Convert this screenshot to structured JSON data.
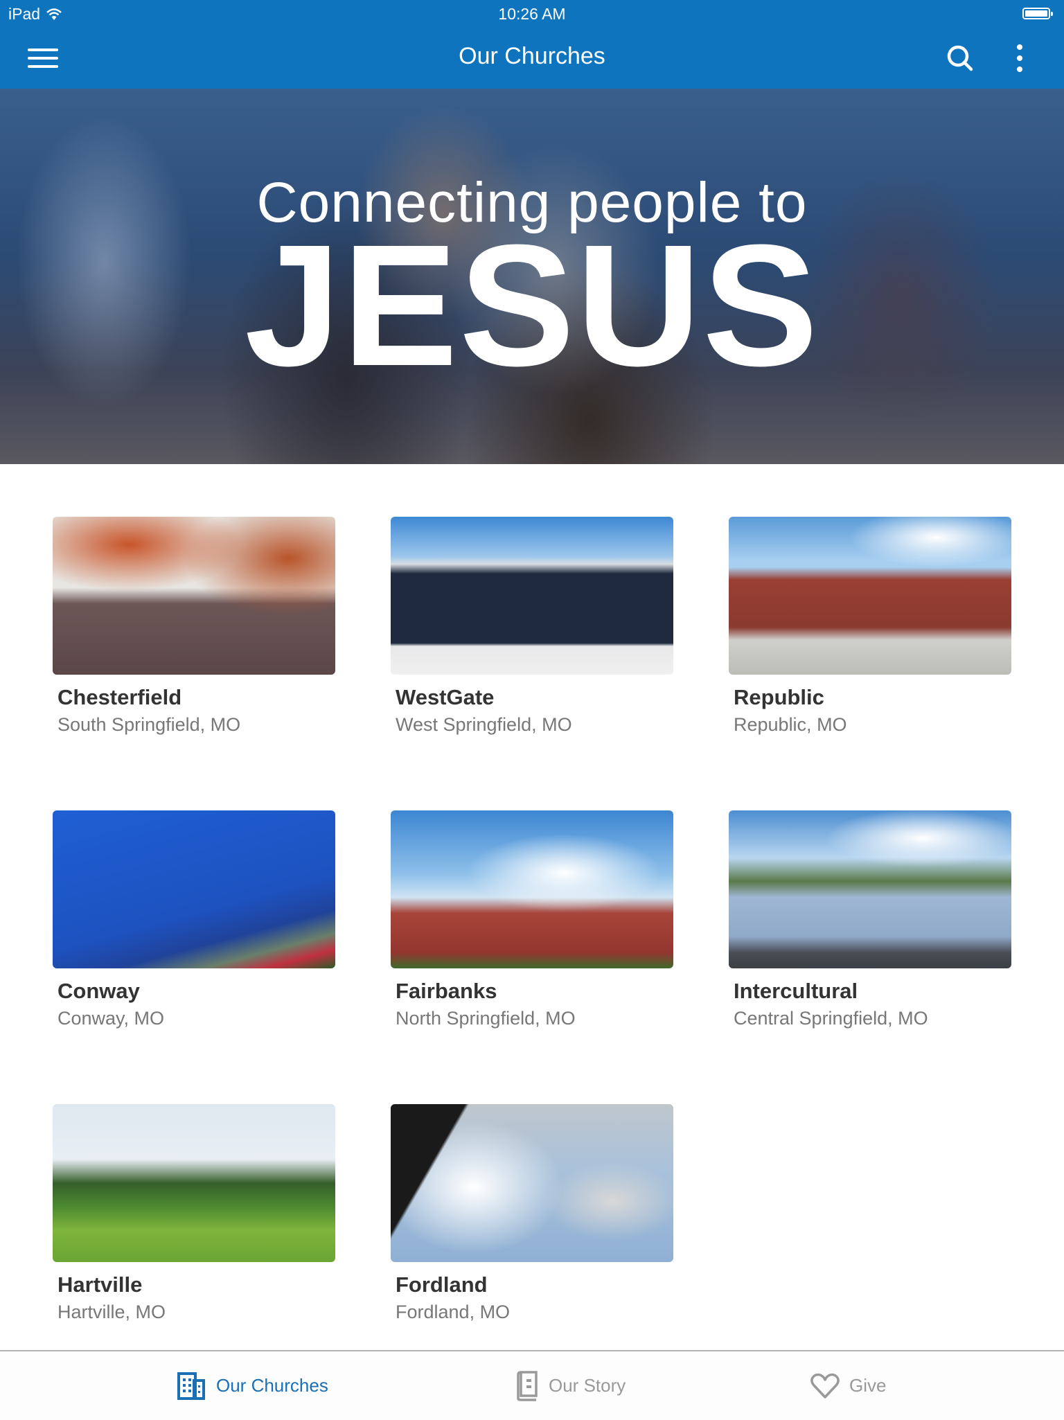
{
  "status_bar": {
    "device": "iPad",
    "time": "10:26 AM",
    "wifi_icon": "wifi-icon",
    "battery_icon": "battery-full-icon"
  },
  "nav_bar": {
    "title": "Our Churches",
    "menu_icon": "hamburger-menu-icon",
    "search_icon": "search-icon",
    "more_icon": "more-vertical-icon",
    "background_color": "#0e74bd"
  },
  "hero": {
    "line1": "Connecting people to",
    "line2": "JESUS"
  },
  "churches": [
    {
      "name": "Chesterfield",
      "location": "South Springfield, MO"
    },
    {
      "name": "WestGate",
      "location": "West Springfield, MO"
    },
    {
      "name": "Republic",
      "location": "Republic, MO"
    },
    {
      "name": "Conway",
      "location": "Conway, MO"
    },
    {
      "name": "Fairbanks",
      "location": "North Springfield, MO"
    },
    {
      "name": "Intercultural",
      "location": "Central Springfield, MO"
    },
    {
      "name": "Hartville",
      "location": "Hartville, MO"
    },
    {
      "name": "Fordland",
      "location": "Fordland, MO"
    }
  ],
  "tab_bar": {
    "tabs": [
      {
        "label": "Our Churches",
        "icon": "building-icon",
        "active": true
      },
      {
        "label": "Our Story",
        "icon": "book-icon",
        "active": false
      },
      {
        "label": "Give",
        "icon": "heart-icon",
        "active": false
      }
    ],
    "active_color": "#1a6fb5",
    "inactive_color": "#999999"
  }
}
